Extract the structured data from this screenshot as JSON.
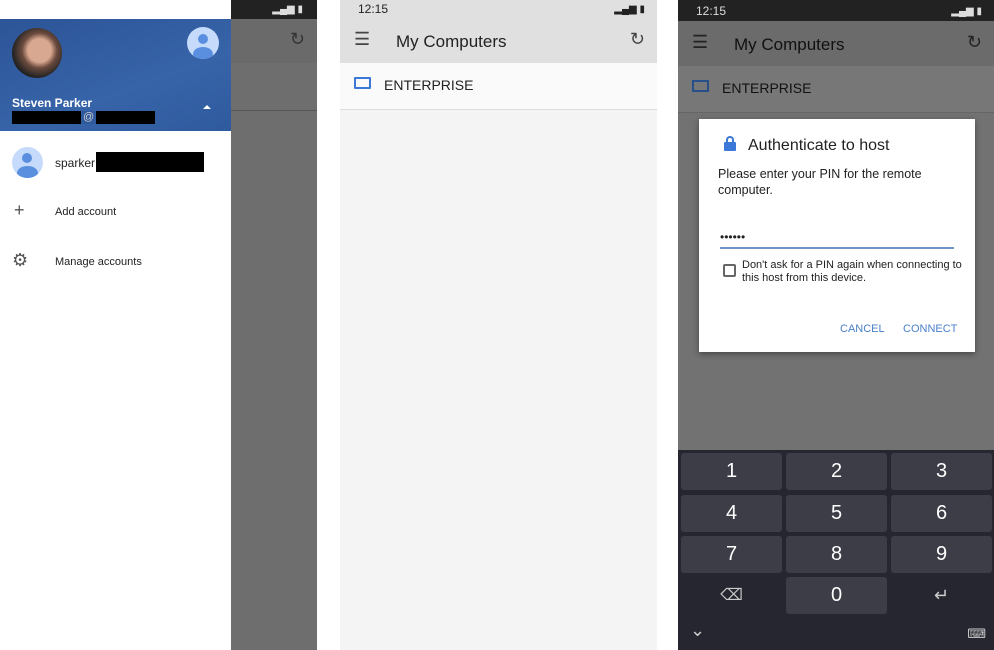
{
  "status": {
    "time": "12:15",
    "icons": "wifi signal battery"
  },
  "drawer": {
    "user_name": "Steven Parker",
    "email_at": "@",
    "account_name": "sparker",
    "add_account": "Add account",
    "manage_accounts": "Manage accounts",
    "header_color": "#2f5a9e"
  },
  "main": {
    "title": "My Computers",
    "computers": [
      {
        "name": "ENTERPRISE"
      }
    ]
  },
  "dialog": {
    "title": "Authenticate to host",
    "message": "Please enter your PIN for the remote computer.",
    "pin_value": "••••••",
    "checkbox_label": "Don't ask for a PIN again when connecting to this host from this device.",
    "checkbox_checked": false,
    "cancel": "CANCEL",
    "connect": "CONNECT",
    "accent": "#4a80c9"
  },
  "keyboard": {
    "keys": [
      "1",
      "2",
      "3",
      "4",
      "5",
      "6",
      "7",
      "8",
      "9",
      "0"
    ],
    "backspace": "⌫",
    "enter": "↵",
    "hide": "⌄",
    "switch": "⌨"
  }
}
